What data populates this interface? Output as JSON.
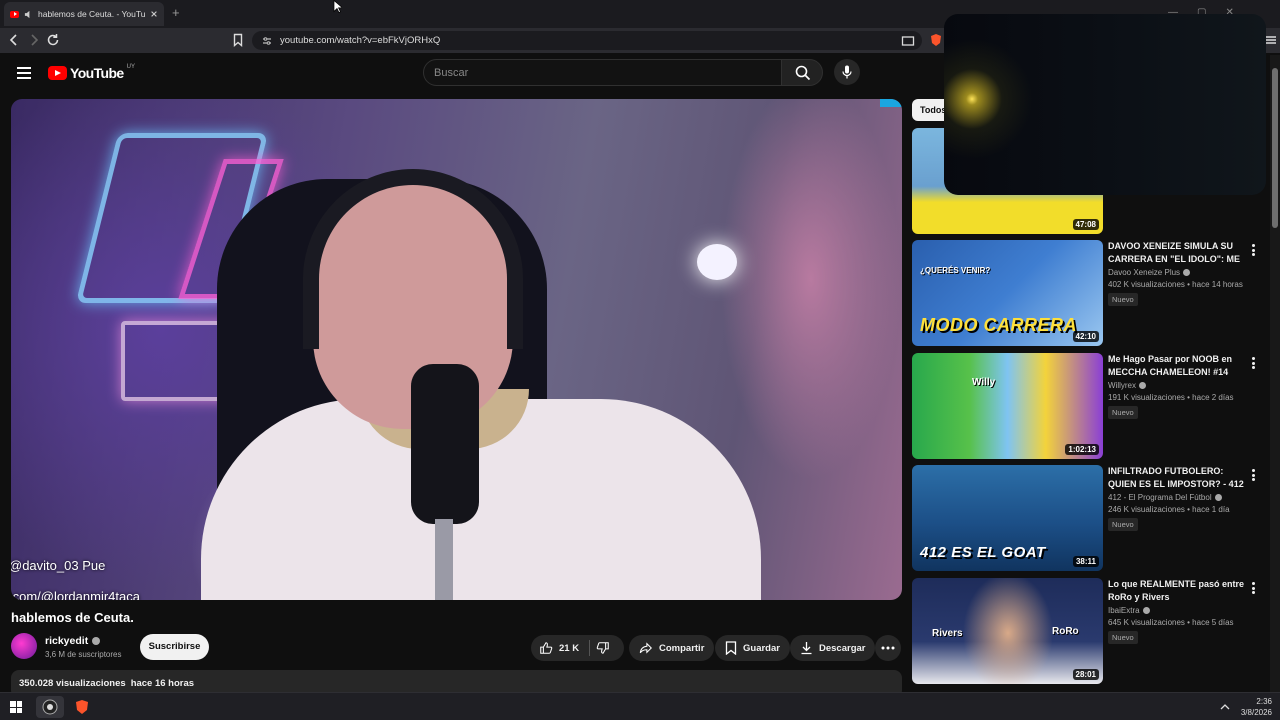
{
  "browser": {
    "tab_title": "hablemos de Ceuta. - YouTube",
    "url": "youtube.com/watch?v=ebFkVjORHxQ"
  },
  "header": {
    "logo_text": "YouTube",
    "country_code": "UY",
    "search_placeholder": "Buscar"
  },
  "player": {
    "chat_line_1": "@davito_03 Pue",
    "chat_line_2": ".com/@lordanmir4taca"
  },
  "video": {
    "title": "hablemos de Ceuta.",
    "channel": "rickyedit",
    "subscribers": "3,6 M de suscriptores",
    "subscribe_label": "Suscribirse",
    "likes": "21 K",
    "share_label": "Compartir",
    "save_label": "Guardar",
    "download_label": "Descargar",
    "views": "350.028 visualizaciones",
    "age": "hace 16 horas"
  },
  "sidebar": {
    "chip_all": "Todos",
    "items": [
      {
        "title": "",
        "channel": "",
        "meta": "",
        "badge": "",
        "duration": "47:08",
        "caption": ""
      },
      {
        "title": "DAVOO XENEIZE SIMULA SU CARRERA EN \"EL IDOLO\": ME ...",
        "channel": "Davoo Xeneize Plus",
        "meta": "402 K visualizaciones • hace 14 horas",
        "badge": "Nuevo",
        "duration": "42:10",
        "caption": "MODO CARRERA",
        "tag": "¿QUERÉS VENIR?"
      },
      {
        "title": "Me Hago Pasar por NOOB en MECCHA CHAMELEON! #14",
        "channel": "Willyrex",
        "meta": "191 K visualizaciones • hace 2 días",
        "badge": "Nuevo",
        "duration": "1:02:13",
        "caption": "",
        "tag": "Willy"
      },
      {
        "title": "INFILTRADO FUTBOLERO: QUIEN ES EL IMPOSTOR? - 412",
        "channel": "412 - El Programa Del Fútbol",
        "meta": "246 K visualizaciones • hace 1 día",
        "badge": "Nuevo",
        "duration": "38:11",
        "caption": "412 ES EL GOAT"
      },
      {
        "title": "Lo que REALMENTE pasó entre RoRo y Rivers",
        "channel": "IbaiExtra",
        "meta": "645 K visualizaciones • hace 5 días",
        "badge": "Nuevo",
        "duration": "28:01",
        "caption": "",
        "tag": "Rivers",
        "tag2": "RoRo"
      }
    ]
  },
  "taskbar": {
    "time": "2:36",
    "date": "3/8/2026"
  },
  "colors": {
    "yt_red": "#ff0000",
    "background": "#0f0f0f",
    "surface": "#272727"
  }
}
